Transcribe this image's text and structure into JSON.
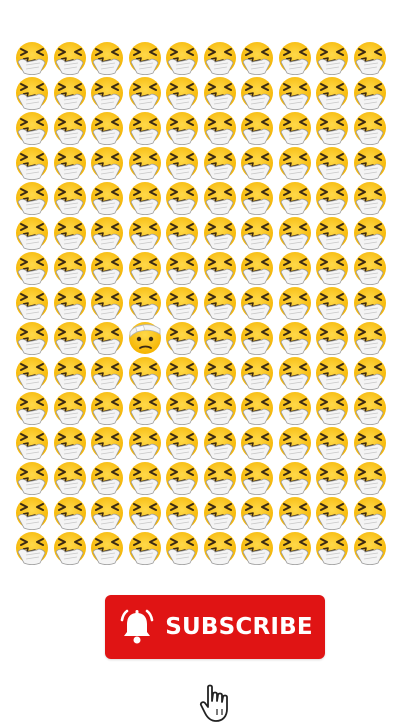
{
  "puzzle": {
    "rows": 15,
    "cols": 10,
    "default_emoji": "sneezing-face",
    "odd_emoji": "face-with-head-bandage",
    "odd_row": 8,
    "odd_col": 3
  },
  "subscribe": {
    "label": "SUBSCRIBE",
    "icon": "bell-icon",
    "color": "#e01414"
  },
  "pointer": {
    "icon": "pointing-hand-cursor-icon"
  }
}
